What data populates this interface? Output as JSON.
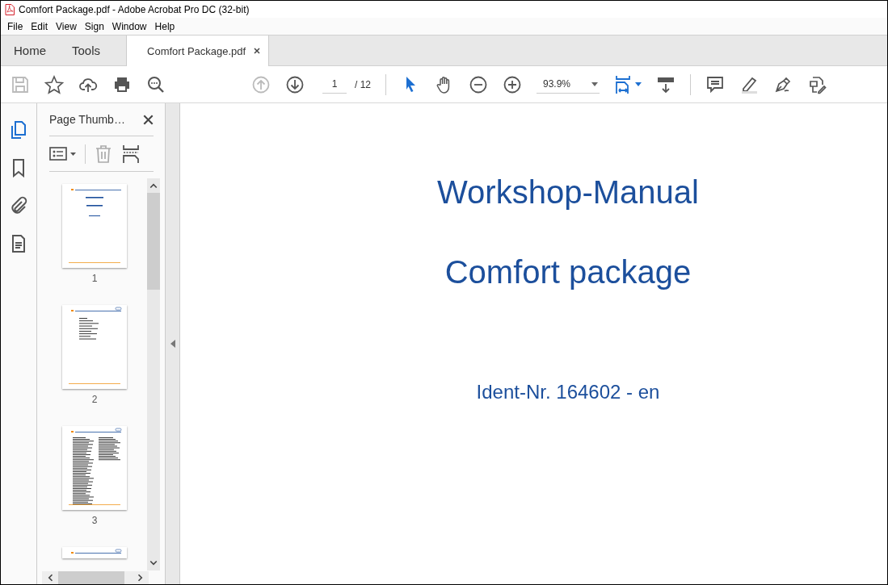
{
  "window": {
    "title": "Comfort Package.pdf - Adobe Acrobat Pro DC (32-bit)"
  },
  "menu": [
    "File",
    "Edit",
    "View",
    "Sign",
    "Window",
    "Help"
  ],
  "tabs": [
    {
      "label": "Home",
      "kind": "nav",
      "selected": false
    },
    {
      "label": "Tools",
      "kind": "nav",
      "selected": false
    },
    {
      "label": "Comfort Package.pdf",
      "kind": "document",
      "selected": true
    }
  ],
  "toolbar": {
    "page": "1",
    "page_total": "/ 12",
    "zoom": "93.9%"
  },
  "panel": {
    "title": "Page Thumb…"
  },
  "thumbnails": [
    {
      "label": "1",
      "kind": "cover"
    },
    {
      "label": "2",
      "kind": "contents"
    },
    {
      "label": "3",
      "kind": "text"
    },
    {
      "kind": "partial"
    }
  ],
  "document": {
    "title": "Workshop-Manual",
    "subtitle": "Comfort package",
    "ident": "Ident-Nr. 164602 - en"
  }
}
